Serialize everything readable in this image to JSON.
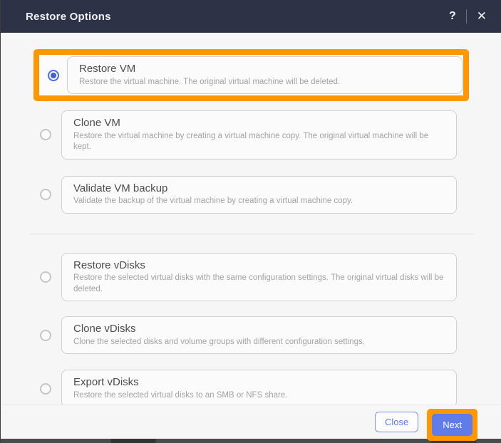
{
  "dialog": {
    "title": "Restore Options",
    "header": {
      "help_icon": "?",
      "close_icon": "✕"
    },
    "options": [
      {
        "title": "Restore VM",
        "description": "Restore the virtual machine. The original virtual machine will be deleted.",
        "selected": true,
        "highlighted": true
      },
      {
        "title": "Clone VM",
        "description": "Restore the virtual machine by creating a virtual machine copy. The original virtual machine will be kept.",
        "selected": false,
        "highlighted": false
      },
      {
        "title": "Validate VM backup",
        "description": "Validate the backup of the virtual machine by creating a virtual machine copy.",
        "selected": false,
        "highlighted": false
      },
      {
        "title": "Restore vDisks",
        "description": "Restore the selected virtual disks with the same configuration settings. The original virtual disks will be deleted.",
        "selected": false,
        "highlighted": false
      },
      {
        "title": "Clone vDisks",
        "description": "Clone the selected disks and volume groups with different configuration settings.",
        "selected": false,
        "highlighted": false
      },
      {
        "title": "Export vDisks",
        "description": "Restore the selected virtual disks to an SMB or NFS share.",
        "selected": false,
        "highlighted": false
      }
    ],
    "footer": {
      "close_label": "Close",
      "next_label": "Next"
    },
    "colors": {
      "header_bg": "#2e3247",
      "accent_blue": "#5f7ce8",
      "highlight_orange": "#ff9800",
      "body_bg": "#f6f6f7"
    }
  }
}
